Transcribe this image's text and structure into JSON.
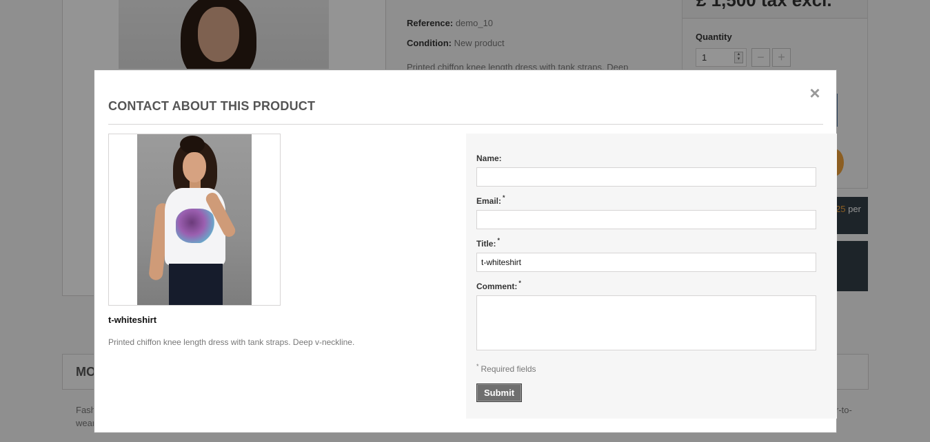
{
  "background": {
    "price_partial": "£ 1,500 tax excl.",
    "reference_label": "Reference:",
    "reference_value": "demo_10",
    "condition_label": "Condition:",
    "condition_value": "New product",
    "description_partial": "Printed chiffon knee length dress with tank straps. Deep",
    "quantity_label": "Quantity",
    "quantity_value": "1",
    "minus_label": "−",
    "plus_label": "+",
    "installment_number": "25",
    "installment_per": "per",
    "more_info_partial": "MO",
    "fashion_line1": "Fash",
    "fashion_line2": "wear",
    "right_text_partial": "r-to-"
  },
  "modal": {
    "title": "CONTACT ABOUT THIS PRODUCT",
    "close_symbol": "×",
    "product": {
      "name": "t-whiteshirt",
      "description": "Printed chiffon knee length dress with tank straps. Deep v-neckline."
    },
    "form": {
      "name_label": "Name:",
      "name_value": "",
      "email_label": "Email:",
      "email_value": "",
      "title_label": "Title:",
      "title_value": "t-whiteshirt",
      "comment_label": "Comment:",
      "comment_value": "",
      "required_marker": "*",
      "required_note": "Required fields",
      "submit_label": "Submit"
    }
  },
  "colors": {
    "overlay": "rgba(0,0,0,0.42)",
    "submit_button": "#6f6f6f",
    "form_panel": "#f6f6f6",
    "dark_blocks": "#333f48",
    "accent_orange": "#f1a33b"
  }
}
